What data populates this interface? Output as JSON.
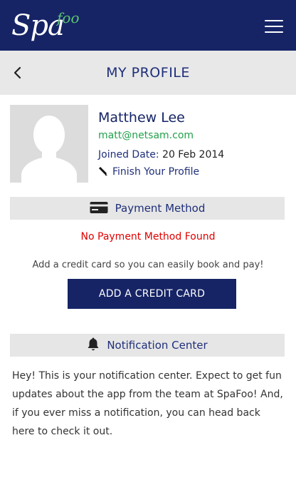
{
  "header": {
    "logo_main": "Spa",
    "logo_sub": "foo",
    "menu_icon": "hamburger-menu-icon",
    "background_color": "#162466",
    "logo_accent_color": "#5cc66f"
  },
  "titlebar": {
    "back_icon": "chevron-left-icon",
    "title": "MY PROFILE"
  },
  "profile": {
    "name": "Matthew Lee",
    "email": "matt@netsam.com",
    "joined_label": "Joined Date:",
    "joined_date": "20 Feb 2014",
    "finish_label": "Finish Your Profile",
    "finish_icon": "pencil-icon",
    "avatar_icon": "user-silhouette-icon"
  },
  "payment": {
    "section_title": "Payment Method",
    "section_icon": "credit-card-icon",
    "empty_message": "No Payment Method Found",
    "hint": "Add a credit card so you can easily book and pay!",
    "add_button": "ADD A CREDIT CARD",
    "error_color": "#e00000"
  },
  "notifications": {
    "section_title": "Notification Center",
    "section_icon": "bell-icon",
    "body": "Hey! This is your notification center. Expect to get fun updates about the app from the team at SpaFoo! And, if you ever miss a notification, you can head back here to check it out."
  }
}
